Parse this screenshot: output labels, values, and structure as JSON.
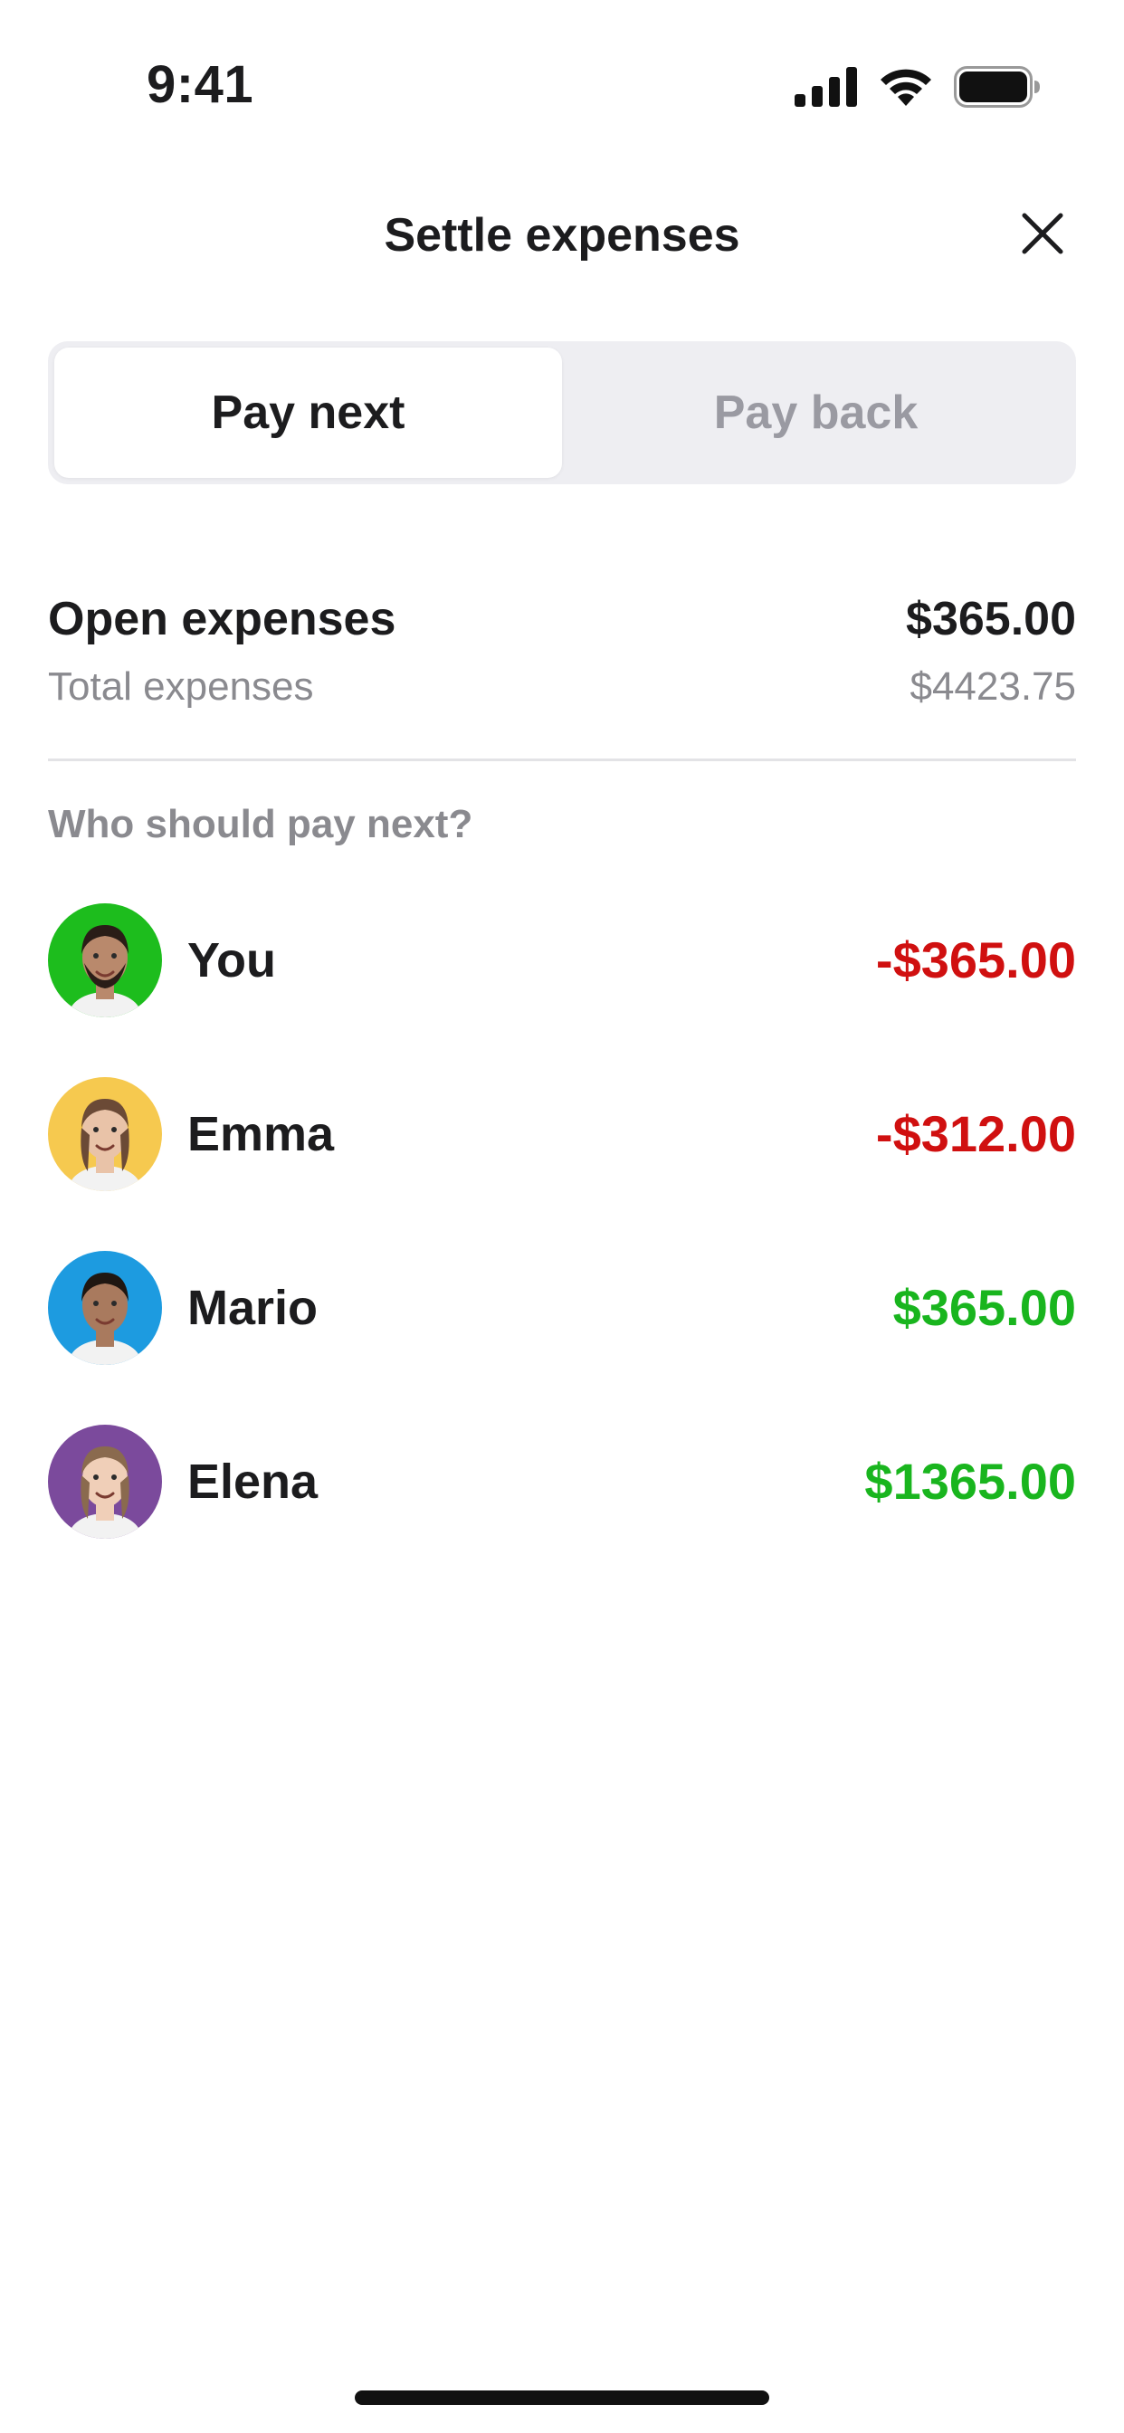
{
  "status_bar": {
    "time": "9:41",
    "icons": [
      "signal-icon",
      "wifi-icon",
      "battery-icon"
    ]
  },
  "header": {
    "title": "Settle expenses",
    "close_icon": "close-icon"
  },
  "tabs": [
    {
      "label": "Pay next",
      "active": true
    },
    {
      "label": "Pay back",
      "active": false
    }
  ],
  "summary": {
    "open_label": "Open expenses",
    "open_value": "$365.00",
    "total_label": "Total expenses",
    "total_value": "$4423.75"
  },
  "section_label": "Who should pay next?",
  "people": [
    {
      "name": "You",
      "amount": "-$365.00",
      "amount_color": "#d01010",
      "avatar_color": "#1dbd1d"
    },
    {
      "name": "Emma",
      "amount": "-$312.00",
      "amount_color": "#d01010",
      "avatar_color": "#f6c94f"
    },
    {
      "name": "Mario",
      "amount": "$365.00",
      "amount_color": "#19b51e",
      "avatar_color": "#1d9be0"
    },
    {
      "name": "Elena",
      "amount": "$1365.00",
      "amount_color": "#19b51e",
      "avatar_color": "#7b4a9c"
    }
  ],
  "colors": {
    "negative": "#d01010",
    "positive": "#19b51e",
    "muted": "#8a8a8f"
  }
}
